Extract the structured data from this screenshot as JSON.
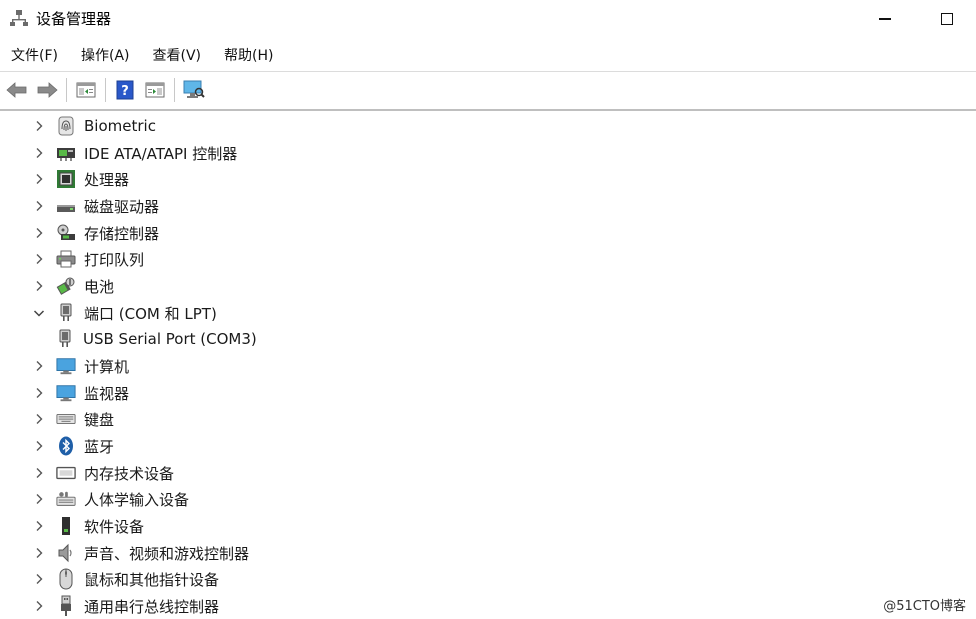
{
  "window": {
    "title": "设备管理器",
    "icon": "device-manager-icon"
  },
  "menu": {
    "items": [
      "文件(F)",
      "操作(A)",
      "查看(V)",
      "帮助(H)"
    ]
  },
  "toolbar": {
    "icons": [
      "back-arrow-icon",
      "forward-arrow-icon",
      "properties-icon",
      "help-icon",
      "show-hide-console-tree-icon",
      "scan-hardware-icon"
    ]
  },
  "tree": {
    "nodes": [
      {
        "label": "Biometric",
        "expanded": false,
        "icon": "fingerprint-icon"
      },
      {
        "label": "IDE ATA/ATAPI 控制器",
        "expanded": false,
        "icon": "ide-controller-icon"
      },
      {
        "label": "处理器",
        "expanded": false,
        "icon": "processor-icon"
      },
      {
        "label": "磁盘驱动器",
        "expanded": false,
        "icon": "disk-drive-icon"
      },
      {
        "label": "存储控制器",
        "expanded": false,
        "icon": "storage-controller-icon"
      },
      {
        "label": "打印队列",
        "expanded": false,
        "icon": "printer-icon"
      },
      {
        "label": "电池",
        "expanded": false,
        "icon": "battery-icon"
      },
      {
        "label": "端口 (COM 和 LPT)",
        "expanded": true,
        "icon": "port-icon"
      },
      {
        "label": "USB Serial Port (COM3)",
        "child": true,
        "icon": "serial-port-icon"
      },
      {
        "label": "计算机",
        "expanded": false,
        "icon": "computer-icon"
      },
      {
        "label": "监视器",
        "expanded": false,
        "icon": "monitor-icon"
      },
      {
        "label": "键盘",
        "expanded": false,
        "icon": "keyboard-icon"
      },
      {
        "label": "蓝牙",
        "expanded": false,
        "icon": "bluetooth-icon"
      },
      {
        "label": "内存技术设备",
        "expanded": false,
        "icon": "memory-device-icon"
      },
      {
        "label": "人体学输入设备",
        "expanded": false,
        "icon": "hid-icon"
      },
      {
        "label": "软件设备",
        "expanded": false,
        "icon": "software-device-icon"
      },
      {
        "label": "声音、视频和游戏控制器",
        "expanded": false,
        "icon": "speaker-icon"
      },
      {
        "label": "鼠标和其他指针设备",
        "expanded": false,
        "icon": "mouse-icon"
      },
      {
        "label": "通用串行总线控制器",
        "expanded": false,
        "icon": "usb-icon"
      }
    ]
  },
  "watermark": "@51CTO博客",
  "colors": {
    "accent_blue": "#2a7fd4",
    "monitor_blue": "#4aa3df",
    "icon_gray": "#6b6b6b"
  }
}
